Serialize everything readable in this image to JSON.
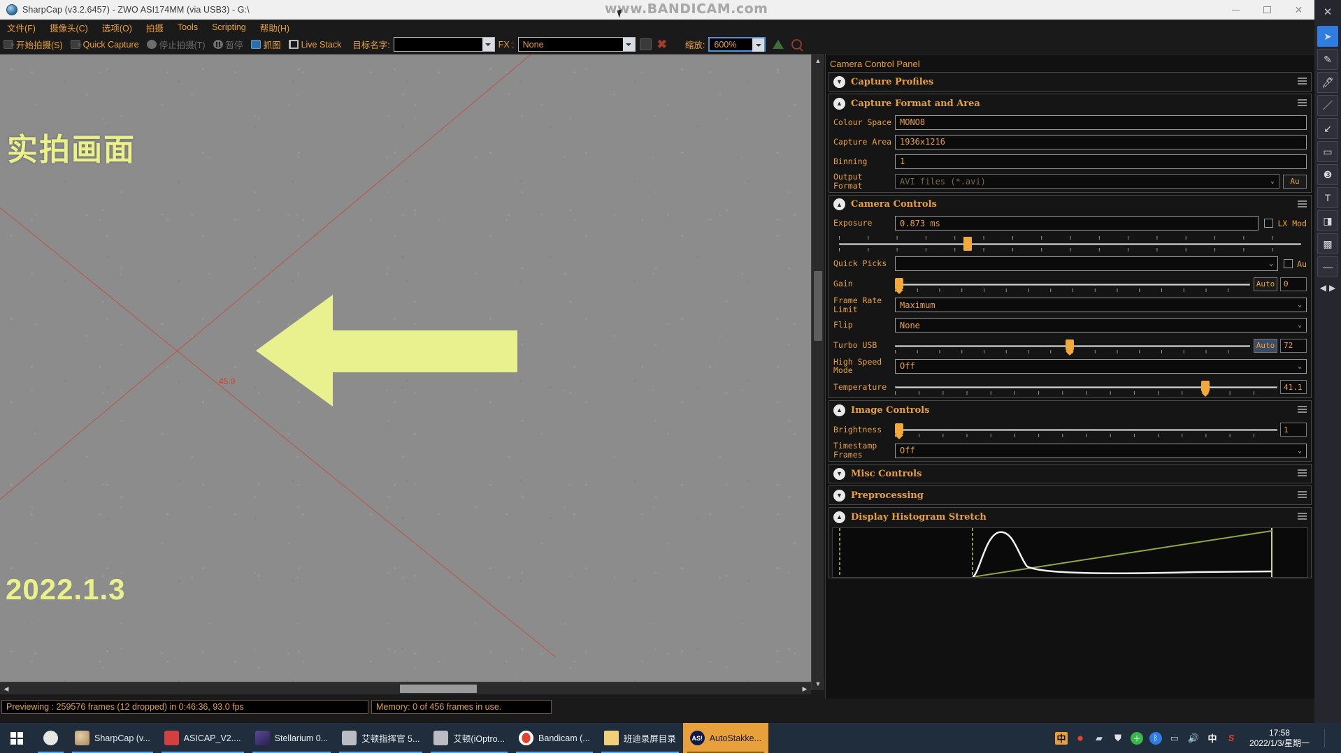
{
  "window": {
    "title": "SharpCap (v3.2.6457) - ZWO ASI174MM (via USB3) - G:\\",
    "title_dim": "",
    "icon": "camera-icon",
    "minimize": "–",
    "maximize": "❐",
    "close": "✕",
    "watermark": "www.BANDICAM.com"
  },
  "menubar": {
    "items": [
      {
        "label": "文件(F)"
      },
      {
        "label": "摄像头(C)"
      },
      {
        "label": "选项(O)"
      },
      {
        "label": "拍摄"
      },
      {
        "label": "Tools"
      },
      {
        "label": "Scripting"
      },
      {
        "label": "帮助(H)"
      }
    ]
  },
  "toolbar": {
    "start_capture": "开始拍摄(S)",
    "quick_capture": "Quick Capture",
    "stop_capture": "停止拍摄(T)",
    "pause": "暂停",
    "snapshot": "抓图",
    "live_stack": "Live Stack",
    "target_name_label": "目标名字:",
    "target_name_value": "",
    "fx_label": "FX :",
    "fx_value": "None",
    "zoom_label": "缩放:",
    "zoom_value": "600%"
  },
  "preview": {
    "overlay_text": "实拍画面",
    "overlay_date": "2022.1.3",
    "reticle_label": "45.0",
    "annotation": "left-arrow-annotation"
  },
  "status": {
    "preview_text": "Previewing : 259576 frames (12 dropped) in 0:46:36, 93.0 fps",
    "memory_text": "Memory: 0 of 456 frames in use."
  },
  "camera_panel": {
    "title": "Camera Control Panel",
    "sections": [
      {
        "name": "Capture Profiles",
        "expanded": false
      },
      {
        "name": "Capture Format and Area",
        "expanded": true
      },
      {
        "name": "Camera Controls",
        "expanded": true
      },
      {
        "name": "Image Controls",
        "expanded": true
      },
      {
        "name": "Misc Controls",
        "expanded": false
      },
      {
        "name": "Preprocessing",
        "expanded": false
      },
      {
        "name": "Display Histogram Stretch",
        "expanded": true
      }
    ],
    "capture_format": {
      "colour_space_label": "Colour Space",
      "colour_space_value": "MONO8",
      "capture_area_label": "Capture Area",
      "capture_area_value": "1936x1216",
      "binning_label": "Binning",
      "binning_value": "1",
      "output_format_label": "Output Format",
      "output_format_value": "AVI files (*.avi)",
      "output_format_auto": "Au"
    },
    "camera_controls": {
      "exposure_label": "Exposure",
      "exposure_value": "0.873 ms",
      "lx_mode_label": "LX Mod",
      "quick_picks_label": "Quick Picks",
      "quick_picks_value": "",
      "quick_picks_auto": "Au",
      "gain_label": "Gain",
      "gain_auto": "Auto",
      "gain_value": "0",
      "frame_rate_limit_label": "Frame Rate Limit",
      "frame_rate_limit_value": "Maximum",
      "flip_label": "Flip",
      "flip_value": "None",
      "turbo_usb_label": "Turbo USB",
      "turbo_usb_auto": "Auto",
      "turbo_usb_value": "72",
      "high_speed_mode_label": "High Speed Mode",
      "high_speed_mode_value": "Off",
      "temperature_label": "Temperature",
      "temperature_value": "41.1"
    },
    "image_controls": {
      "brightness_label": "Brightness",
      "brightness_value": "1",
      "timestamp_frames_label": "Timestamp Frames",
      "timestamp_frames_value": "Off"
    }
  },
  "toolstrip": {
    "close": "✕",
    "tools": [
      {
        "name": "select-cursor",
        "glyph": "➤",
        "selected": true
      },
      {
        "name": "pencil",
        "glyph": "✎",
        "selected": false
      },
      {
        "name": "highlighter",
        "glyph": "🖊",
        "selected": false
      },
      {
        "name": "line",
        "glyph": "／",
        "selected": false
      },
      {
        "name": "arrow",
        "glyph": "↙",
        "selected": false
      },
      {
        "name": "rectangle",
        "glyph": "▭",
        "selected": false
      },
      {
        "name": "numbering",
        "glyph": "❸",
        "selected": false
      },
      {
        "name": "text",
        "glyph": "T",
        "selected": false
      },
      {
        "name": "eraser",
        "glyph": "◨",
        "selected": false
      },
      {
        "name": "mosaic",
        "glyph": "▩",
        "selected": false
      },
      {
        "name": "underline",
        "glyph": "—",
        "selected": false
      }
    ],
    "nav_prev": "◀",
    "nav_next": "▶"
  },
  "taskbar": {
    "start": "windows-start",
    "pinned": {
      "name": "sharpcap-pinned",
      "label": ""
    },
    "apps": [
      {
        "label": "SharpCap (v...",
        "icon": "sharpcap-icon",
        "active": false
      },
      {
        "label": "ASICAP_V2....",
        "icon": "asicap-icon",
        "active": false
      },
      {
        "label": "Stellarium 0...",
        "icon": "stellarium-icon",
        "active": false
      },
      {
        "label": "艾顿指挥官 5...",
        "icon": "ioptron-icon",
        "active": false
      },
      {
        "label": "艾顿(iOptro...",
        "icon": "ioptron-icon",
        "active": false
      },
      {
        "label": "Bandicam (...",
        "icon": "bandicam-icon",
        "active": false
      },
      {
        "label": "班迪录屏目录",
        "icon": "folder-icon",
        "active": false
      },
      {
        "label": "AutoStakke...",
        "icon": "autostakkert-icon",
        "active": true
      }
    ],
    "tray": [
      {
        "name": "ime-chinese-icon",
        "glyph": "中"
      },
      {
        "name": "record-icon",
        "glyph": "●"
      },
      {
        "name": "wifi-icon",
        "glyph": "◞"
      },
      {
        "name": "security-icon",
        "glyph": "🛡"
      },
      {
        "name": "update-icon",
        "glyph": "✚"
      },
      {
        "name": "bluetooth-icon",
        "glyph": "✦"
      },
      {
        "name": "battery-icon",
        "glyph": "▬"
      },
      {
        "name": "volume-icon",
        "glyph": "◁"
      },
      {
        "name": "ime-mode-icon",
        "glyph": "中"
      },
      {
        "name": "sogou-icon",
        "glyph": "S"
      }
    ],
    "clock_time": "17:58",
    "clock_date": "2022/1/3/星期一",
    "show_desktop": "show-desktop-button"
  }
}
